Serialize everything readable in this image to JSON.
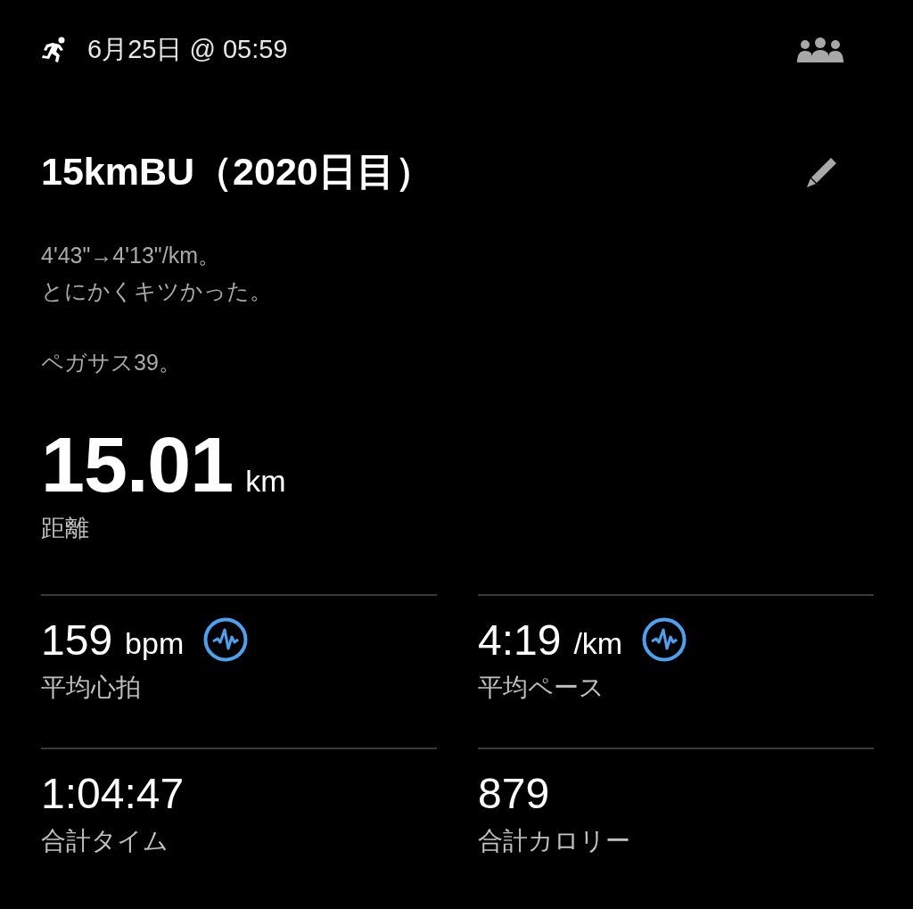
{
  "header": {
    "date": "6月25日 @ 05:59"
  },
  "title": "15kmBU（2020日目）",
  "description": [
    [
      "4'43\"→4'13\"/km。",
      "とにかくキツかった。"
    ],
    [
      "ペガサス39。"
    ]
  ],
  "distance": {
    "value": "15.01",
    "unit": "km",
    "label": "距離"
  },
  "stats": [
    {
      "value": "159",
      "unit": "bpm",
      "label": "平均心拍",
      "graph": true
    },
    {
      "value": "4:19",
      "unit": "/km",
      "label": "平均ペース",
      "graph": true
    },
    {
      "value": "1:04:47",
      "label": "合計タイム",
      "graph": false
    },
    {
      "value": "879",
      "label": "合計カロリー",
      "graph": false
    }
  ]
}
